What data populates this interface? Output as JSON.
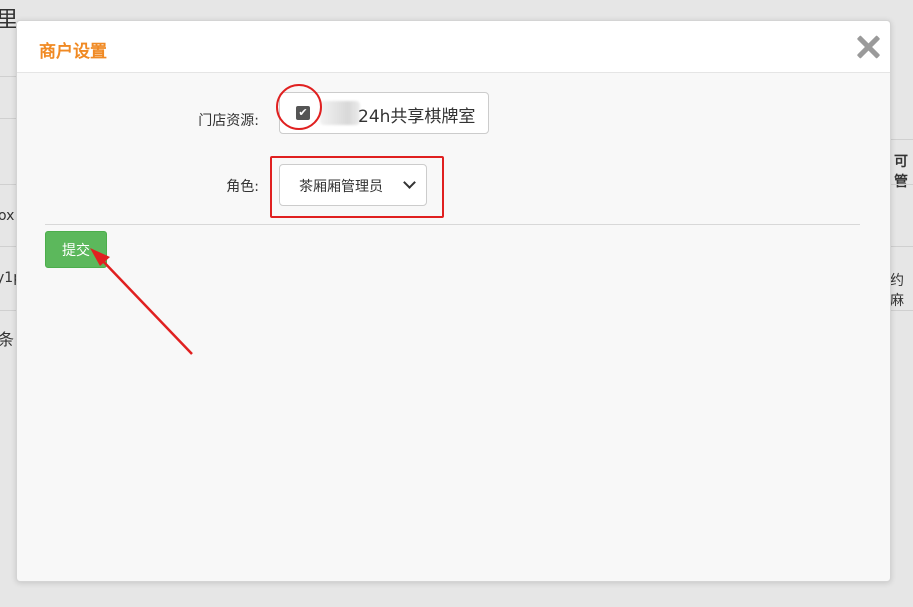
{
  "background": {
    "fragments": [
      "里",
      "可管",
      "ox",
      "y1p",
      "约麻",
      "条"
    ]
  },
  "modal": {
    "title": "商户设置",
    "close_icon": "close-icon"
  },
  "form": {
    "store_label": "门店资源:",
    "store_checked": true,
    "store_name": "24h共享棋牌室",
    "role_label": "角色:",
    "role_selected": "茶厢厢管理员",
    "submit_label": "提交"
  },
  "annotation_color": "#e02020",
  "colors": {
    "title": "#f08a24",
    "submit": "#5cb85c"
  }
}
